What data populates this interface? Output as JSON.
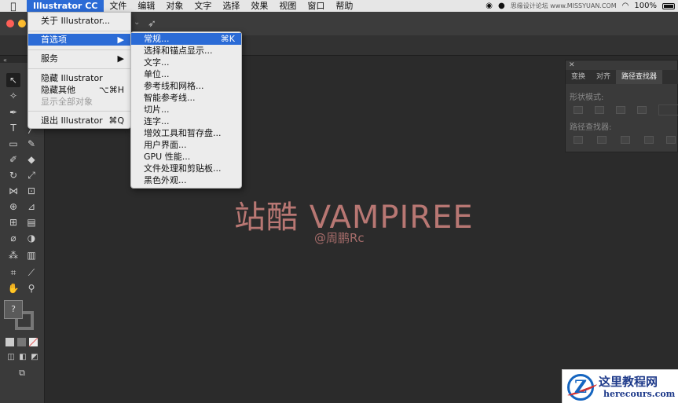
{
  "menubar": {
    "apple_icon": "apple-icon",
    "items": [
      "Illustrator CC",
      "文件",
      "编辑",
      "对象",
      "文字",
      "选择",
      "效果",
      "视图",
      "窗口",
      "帮助"
    ],
    "battery": "100%",
    "watermark": "思缘设计论坛 www.MISSYUAN.COM"
  },
  "app_menu": {
    "items": [
      {
        "label": "关于 Illustrator...",
        "shortcut": ""
      },
      {
        "label": "首选项",
        "shortcut": "▶"
      },
      {
        "label": "服务",
        "shortcut": "▶"
      },
      {
        "label": "隐藏 Illustrator",
        "shortcut": ""
      },
      {
        "label": "隐藏其他",
        "shortcut": "⌥⌘H"
      },
      {
        "label": "显示全部对象",
        "shortcut": ""
      },
      {
        "label": "退出 Illustrator",
        "shortcut": "⌘Q"
      }
    ]
  },
  "prefs_menu": {
    "items": [
      {
        "label": "常规...",
        "shortcut": "⌘K"
      },
      {
        "label": "选择和锚点显示...",
        "shortcut": ""
      },
      {
        "label": "文字...",
        "shortcut": ""
      },
      {
        "label": "单位...",
        "shortcut": ""
      },
      {
        "label": "参考线和网格...",
        "shortcut": ""
      },
      {
        "label": "智能参考线...",
        "shortcut": ""
      },
      {
        "label": "切片...",
        "shortcut": ""
      },
      {
        "label": "连字...",
        "shortcut": ""
      },
      {
        "label": "增效工具和暂存盘...",
        "shortcut": ""
      },
      {
        "label": "用户界面...",
        "shortcut": ""
      },
      {
        "label": "GPU 性能...",
        "shortcut": ""
      },
      {
        "label": "文件处理和剪贴板...",
        "shortcut": ""
      },
      {
        "label": "黑色外观...",
        "shortcut": ""
      }
    ]
  },
  "pathfinder": {
    "tabs": [
      "变换",
      "对齐",
      "路径查找器"
    ],
    "shape_modes_label": "形状模式:",
    "pathfinders_label": "路径查找器:"
  },
  "tools": {
    "fill_placeholder": "?"
  },
  "canvas": {
    "title": "站酷 VAMPIREE",
    "subtitle": "@周鹏Rc"
  },
  "watermark": {
    "title": "这里教程网",
    "url": "herecours.com"
  },
  "colors": {
    "highlight": "#2b6bd6",
    "canvas_text": "#b87773"
  }
}
